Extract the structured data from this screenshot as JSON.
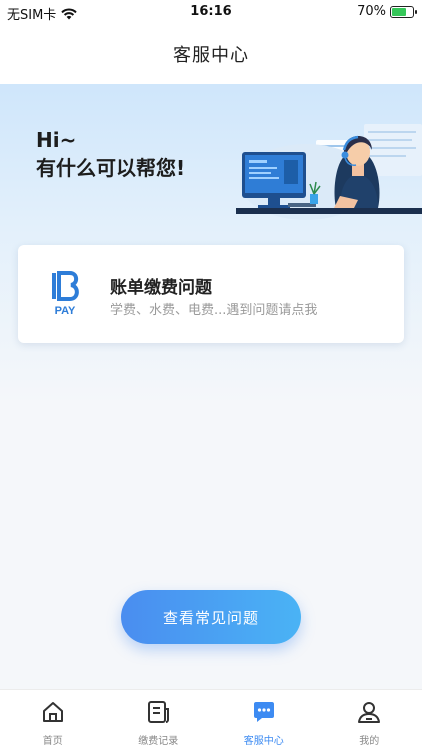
{
  "status_bar": {
    "carrier": "无SIM卡",
    "time": "16:16",
    "battery_percent": "70%",
    "battery_level": 0.7,
    "icons": [
      "wifi-icon",
      "battery-charging-icon"
    ]
  },
  "nav": {
    "title": "客服中心"
  },
  "hero": {
    "greet_line1": "Hi~",
    "greet_line2": "有什么可以帮您!",
    "illustration": "customer-service-agent-illustration"
  },
  "card": {
    "logo_text": "PAY",
    "logo_icon": "b-pay-logo",
    "title": "账单缴费问题",
    "subtitle": "学费、水费、电费...遇到问题请点我"
  },
  "faq_button": {
    "label": "查看常见问题"
  },
  "tabs": [
    {
      "label": "首页",
      "icon": "home-icon",
      "active": false
    },
    {
      "label": "缴费记录",
      "icon": "document-icon",
      "active": false
    },
    {
      "label": "客服中心",
      "icon": "chat-icon",
      "active": true
    },
    {
      "label": "我的",
      "icon": "user-icon",
      "active": false
    }
  ],
  "colors": {
    "accent": "#3d8bf2",
    "button_gradient_start": "#4a8df0",
    "button_gradient_end": "#4ab3f5",
    "battery_green": "#35c759"
  }
}
